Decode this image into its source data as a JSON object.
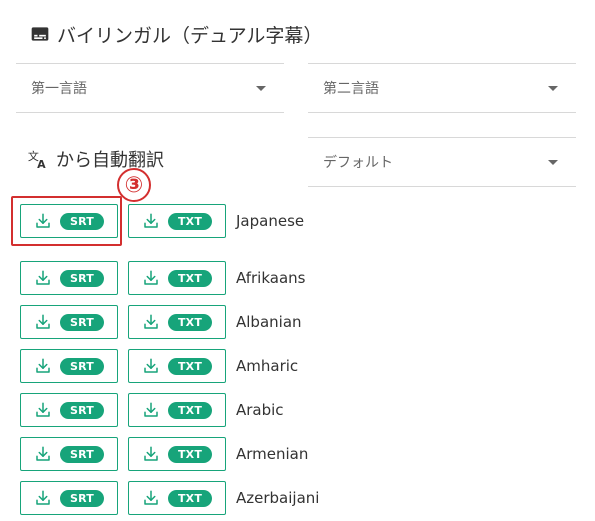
{
  "heading": {
    "title": "バイリンガル（デュアル字幕）",
    "icon": "subtitles-icon"
  },
  "selects": {
    "first_language": "第一言語",
    "second_language": "第二言語",
    "auto_translate": "デフォルト"
  },
  "auto_translate_label": "から自動翻訳",
  "annotation": {
    "step": "③"
  },
  "buttons": {
    "srt_label": "SRT",
    "txt_label": "TXT"
  },
  "languages": [
    "Japanese",
    "Afrikaans",
    "Albanian",
    "Amharic",
    "Arabic",
    "Armenian",
    "Azerbaijani"
  ],
  "colors": {
    "accent": "#17a47a",
    "highlight": "#d32f2f"
  }
}
